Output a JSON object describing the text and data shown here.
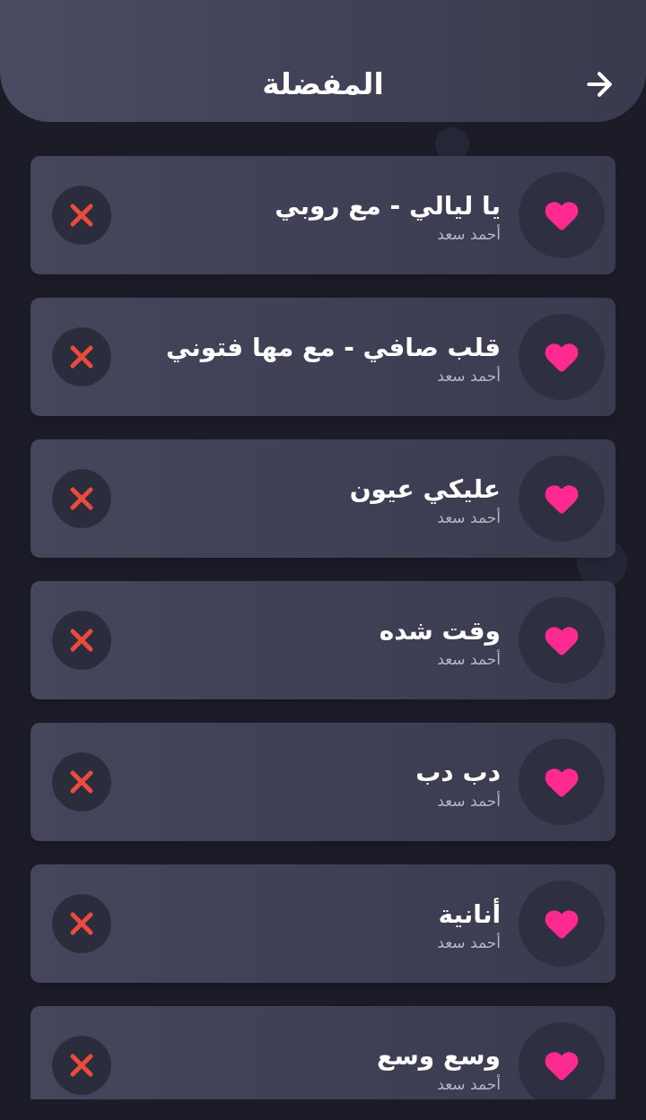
{
  "header": {
    "title": "المفضلة"
  },
  "favorites": [
    {
      "title": "يا ليالي - مع روبي",
      "artist": "أحمد سعد",
      "favorite": true
    },
    {
      "title": "قلب صافي - مع مها فتوني",
      "artist": "أحمد سعد",
      "favorite": true
    },
    {
      "title": "عليكي عيون",
      "artist": "أحمد سعد",
      "favorite": true
    },
    {
      "title": "وقت شده",
      "artist": "أحمد سعد",
      "favorite": true
    },
    {
      "title": "دب دب",
      "artist": "أحمد سعد",
      "favorite": true
    },
    {
      "title": "أنانية",
      "artist": "أحمد سعد",
      "favorite": true
    },
    {
      "title": "وسع وسع",
      "artist": "أحمد سعد",
      "favorite": true
    }
  ]
}
